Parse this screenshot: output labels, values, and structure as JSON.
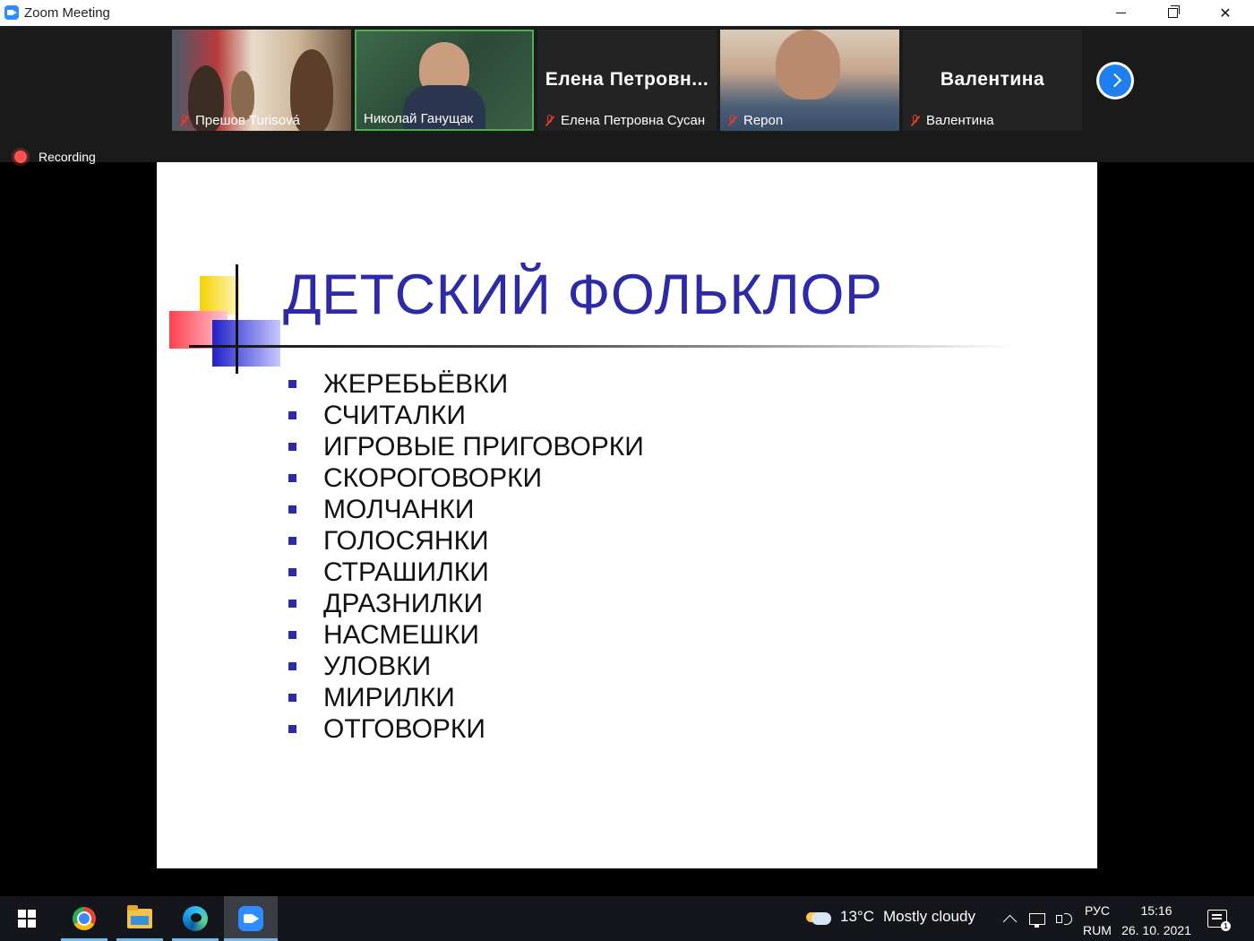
{
  "window": {
    "title": "Zoom Meeting",
    "min_icon": "minimize-icon",
    "max_icon": "restore-icon",
    "close_icon": "close-icon"
  },
  "participants": [
    {
      "name": "Прешов Turisová",
      "muted": true,
      "video": true
    },
    {
      "name": "Николай Ганущак",
      "muted": false,
      "video": true,
      "active_speaker": true
    },
    {
      "name": "Елена Петровна Сусан",
      "display_label": "Елена  Петровн...",
      "muted": true,
      "video": false
    },
    {
      "name": "Repon",
      "muted": true,
      "video": true
    },
    {
      "name": "Валентина",
      "display_label": "Валентина",
      "muted": true,
      "video": false
    }
  ],
  "recording": {
    "label": "Recording"
  },
  "slide": {
    "title": "ДЕТСКИЙ ФОЛЬКЛОР",
    "items": [
      "ЖЕРЕБЬЁВКИ",
      "СЧИТАЛКИ",
      "ИГРОВЫЕ ПРИГОВОРКИ",
      "СКОРОГОВОРКИ",
      "МОЛЧАНКИ",
      "ГОЛОСЯНКИ",
      "СТРАШИЛКИ",
      "ДРАЗНИЛКИ",
      "НАСМЕШКИ",
      "УЛОВКИ",
      "МИРИЛКИ",
      "ОТГОВОРКИ"
    ],
    "title_color": "#2c2aa6"
  },
  "taskbar": {
    "weather": {
      "temp": "13°C",
      "condition": "Mostly cloudy"
    },
    "lang_top": "РУС",
    "lang_bottom": "RUM",
    "time": "15:16",
    "date": "26. 10. 2021",
    "notification_count": "1"
  },
  "colors": {
    "accent": "#2d8cff",
    "active_speaker": "#4caf50",
    "muted": "#e63b2e",
    "recording": "#ff5151"
  }
}
